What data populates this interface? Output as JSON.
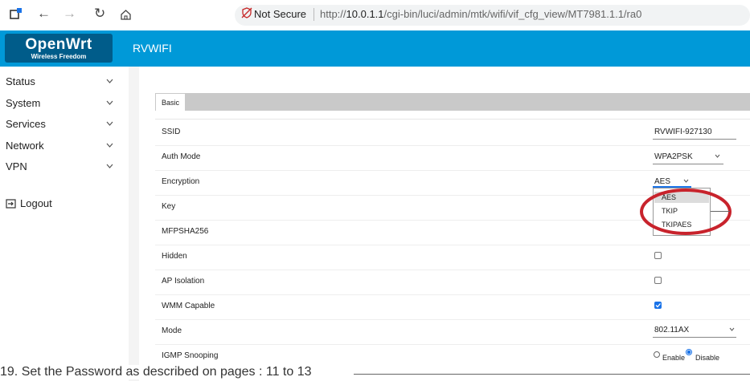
{
  "browser": {
    "security_label": "Not Secure",
    "url_prefix": "http://",
    "url_host": "10.0.1.1",
    "url_path": "/cgi-bin/luci/admin/mtk/wifi/vif_cfg_view/MT7981.1.1/ra0"
  },
  "header": {
    "logo_main": "OpenWrt",
    "logo_sub": "Wireless Freedom",
    "brand": "RVWIFI"
  },
  "sidebar": {
    "items": [
      {
        "label": "Status"
      },
      {
        "label": "System"
      },
      {
        "label": "Services"
      },
      {
        "label": "Network"
      },
      {
        "label": "VPN"
      }
    ],
    "logout": "Logout"
  },
  "tabs": [
    {
      "label": "Basic"
    }
  ],
  "form": {
    "rows": [
      {
        "label": "SSID",
        "value": "RVWIFI-927130"
      },
      {
        "label": "Auth Mode",
        "value": "WPA2PSK"
      },
      {
        "label": "Encryption",
        "value": "AES"
      },
      {
        "label": "Key"
      },
      {
        "label": "MFPSHA256"
      },
      {
        "label": "Hidden",
        "checked": false
      },
      {
        "label": "AP Isolation",
        "checked": false
      },
      {
        "label": "WMM Capable",
        "checked": true
      },
      {
        "label": "Mode",
        "value": "802.11AX"
      },
      {
        "label": "IGMP Snooping",
        "options": [
          "Enable",
          "Disable"
        ],
        "selected": "Disable"
      }
    ]
  },
  "encryption_dropdown": {
    "options": [
      "AES",
      "TKIP",
      "TKIPAES"
    ],
    "highlighted": "AES"
  },
  "annotation_color": "#c8232c",
  "caption": "19. Set the Password as described on pages : 11 to 13"
}
